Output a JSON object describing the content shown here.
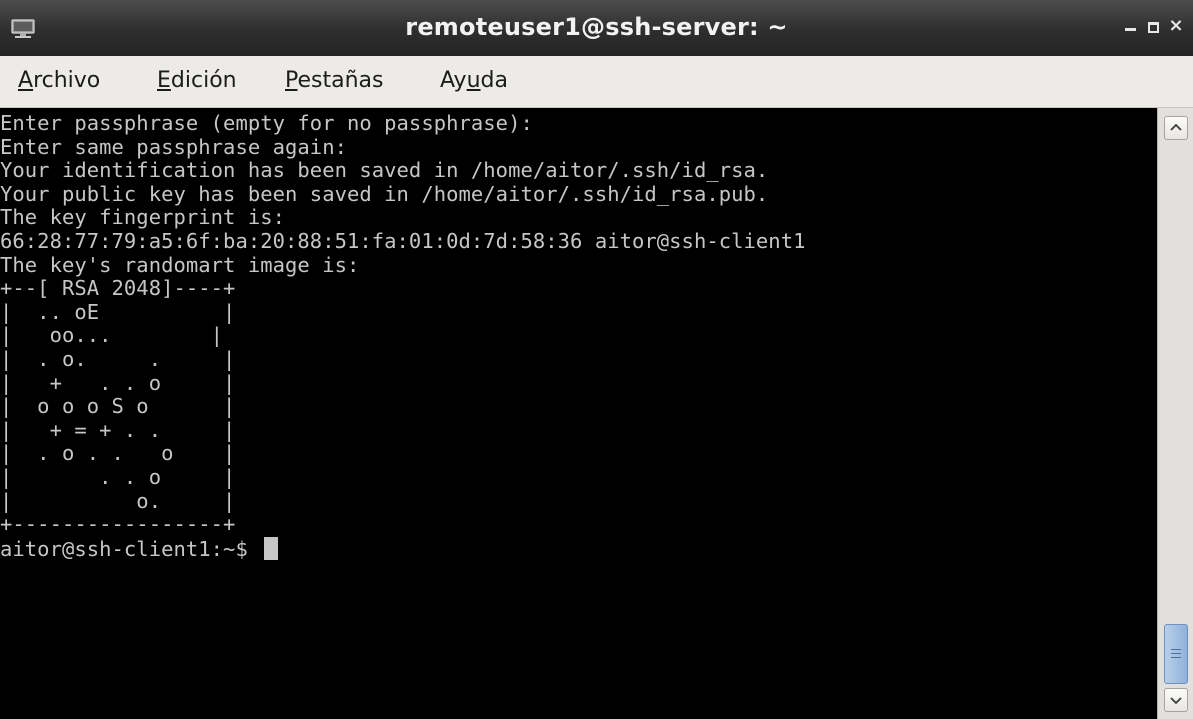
{
  "window": {
    "title": "remoteuser1@ssh-server: ~",
    "icon": "monitor-icon",
    "controls": {
      "minimize": "minimize-icon",
      "maximize": "maximize-icon",
      "close": "×"
    }
  },
  "menubar": {
    "items": [
      {
        "pre": "",
        "mnemonic": "A",
        "post": "rchivo"
      },
      {
        "pre": "",
        "mnemonic": "E",
        "post": "dición"
      },
      {
        "pre": "",
        "mnemonic": "P",
        "post": "estañas"
      },
      {
        "pre": "Ay",
        "mnemonic": "u",
        "post": "da"
      }
    ]
  },
  "terminal": {
    "lines": [
      "Enter passphrase (empty for no passphrase):",
      "Enter same passphrase again:",
      "Your identification has been saved in /home/aitor/.ssh/id_rsa.",
      "Your public key has been saved in /home/aitor/.ssh/id_rsa.pub.",
      "The key fingerprint is:",
      "66:28:77:79:a5:6f:ba:20:88:51:fa:01:0d:7d:58:36 aitor@ssh-client1",
      "The key's randomart image is:",
      "+--[ RSA 2048]----+",
      "|  .. oE          |",
      "|   oo...        |",
      "|  . o.     .     |",
      "|   +   . . o     |",
      "|  o o o S o      |",
      "|   + = + . .     |",
      "|  . o . .   o    |",
      "|       . . o     |",
      "|          o.     |",
      "+-----------------+"
    ],
    "prompt": "aitor@ssh-client1:~$ "
  },
  "scrollbar": {
    "up_icon": "arrow-up-icon",
    "down_icon": "arrow-down-icon",
    "thumb_icon": "grip-icon"
  },
  "colors": {
    "terminal_bg": "#000000",
    "terminal_fg": "#c6c6c6",
    "titlebar_bg": "#2e2e2e",
    "scroll_thumb": "#8fb1da"
  }
}
